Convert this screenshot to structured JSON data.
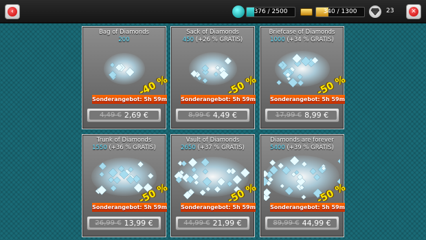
{
  "header": {
    "energy": {
      "value": 376,
      "max": 2500,
      "text": "376 / 2500",
      "color": "#2cc2c2"
    },
    "gold": {
      "value": 340,
      "max": 1300,
      "text": "340 / 1300",
      "color": "#e0a630"
    },
    "diamonds": {
      "text": "23"
    }
  },
  "offers": [
    {
      "title": "Bag of Diamonds",
      "amount": "200",
      "bonus": "",
      "discount": "-40 %",
      "offer_label": "Sonderangebot: 5h 59m",
      "old_price": "4,49 €",
      "new_price": "2,69 €"
    },
    {
      "title": "Sack of Diamonds",
      "amount": "450",
      "bonus": " (+26 % GRATIS)",
      "discount": "-50 %",
      "offer_label": "Sonderangebot: 5h 59m",
      "old_price": "8,99 €",
      "new_price": "4,49 €"
    },
    {
      "title": "Briefcase of Diamonds",
      "amount": "1000",
      "bonus": " (+34 % GRATIS)",
      "discount": "-50 %",
      "offer_label": "Sonderangebot: 5h 59m",
      "old_price": "17,99 €",
      "new_price": "8,99 €"
    },
    {
      "title": "Trunk of Diamonds",
      "amount": "1550",
      "bonus": " (+36 % GRATIS)",
      "discount": "-50 %",
      "offer_label": "Sonderangebot: 5h 59m",
      "old_price": "26,99 €",
      "new_price": "13,99 €"
    },
    {
      "title": "Vault of Diamonds",
      "amount": "2650",
      "bonus": " (+37 % GRATIS)",
      "discount": "-50 %",
      "offer_label": "Sonderangebot: 5h 59m",
      "old_price": "44,99 €",
      "new_price": "21,99 €"
    },
    {
      "title": "Diamonds are forever",
      "amount": "5400",
      "bonus": " (+39 % GRATIS)",
      "discount": "-50 %",
      "offer_label": "Sonderangebot: 5h 59m",
      "old_price": "89,99 €",
      "new_price": "44,99 €"
    }
  ],
  "colors": {
    "offer_banner": "#e04400",
    "discount_text": "#ffe800",
    "background": "#1a6b77"
  }
}
